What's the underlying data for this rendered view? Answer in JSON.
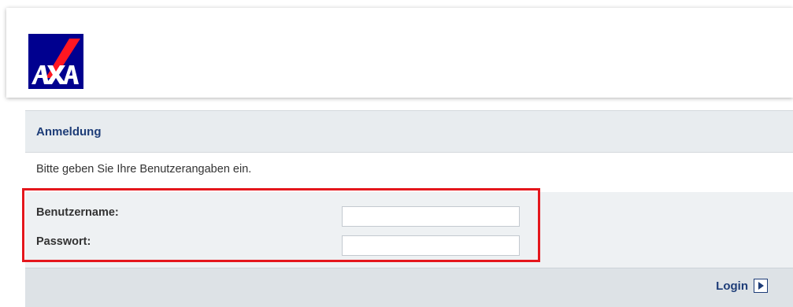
{
  "header": {
    "logo_text": "AXA",
    "colors": {
      "logo_bg": "#00008f",
      "logo_slash": "#ff1721",
      "logo_text": "#ffffff"
    }
  },
  "panel": {
    "title": "Anmeldung",
    "intro": "Bitte geben Sie Ihre Benutzerangaben ein.",
    "fields": {
      "username": {
        "label": "Benutzername:",
        "value": "",
        "placeholder": ""
      },
      "password": {
        "label": "Passwort:",
        "value": "",
        "placeholder": ""
      }
    },
    "login": {
      "label": "Login",
      "icon": "arrow-right-icon"
    }
  },
  "colors": {
    "title": "#1e3d78",
    "highlight": "#e4161c",
    "panel_bg": "#e8ecef"
  }
}
